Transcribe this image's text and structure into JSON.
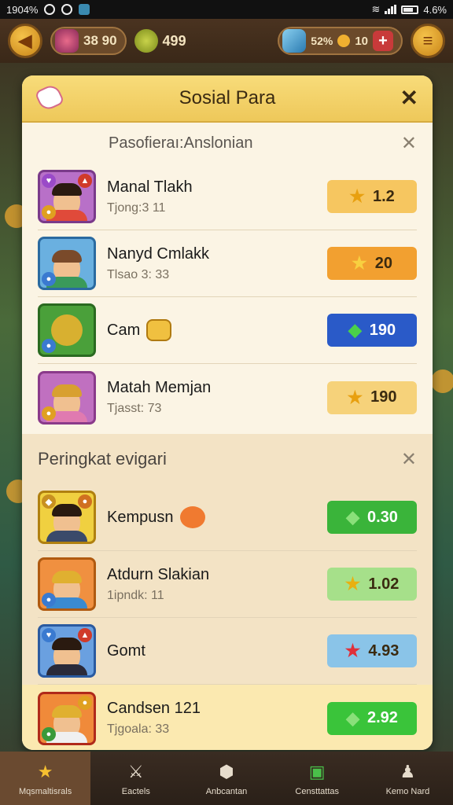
{
  "status_bar": {
    "left_text": "1904%",
    "right_text": "4.6%"
  },
  "top_bar": {
    "resource1": "38 90",
    "resource2": "499",
    "resource3_a": "52%",
    "resource3_b": "10"
  },
  "panel": {
    "title": "Sosial Para",
    "section_friends": {
      "heading": "Pasofieraı:Anslonian",
      "rows": [
        {
          "name": "Manal Tlakh",
          "sub": "Tjong:3 11",
          "score": "1.2",
          "score_icon": "star-icon",
          "btn_color": "#f6c660"
        },
        {
          "name": "Nanyd Cmlakk",
          "sub": "Tlsao 3: 33",
          "score": "20",
          "score_icon": "star-icon",
          "btn_color": "#f2a030"
        },
        {
          "name": "Cam",
          "sub": "",
          "score": "190",
          "score_icon": "gem-icon",
          "btn_color": "#2a5ac8"
        },
        {
          "name": "Matah Memjan",
          "sub": "Tjasst: 73",
          "score": "190",
          "score_icon": "star-icon",
          "btn_color": "#f6d27a"
        }
      ]
    },
    "section_ranking": {
      "heading": "Peringkat evigari",
      "rows": [
        {
          "name": "Kempusn",
          "sub": "",
          "score": "0.30",
          "score_icon": "gem-icon",
          "btn_color": "#3ab43a"
        },
        {
          "name": "Atdurn Slakian",
          "sub": "1ipndk: 11",
          "score": "1.02",
          "score_icon": "star-icon",
          "btn_color": "#a6e08a"
        },
        {
          "name": "Gomt",
          "sub": "",
          "score": "4.93",
          "score_icon": "star-icon",
          "btn_color": "#8ac4e8"
        },
        {
          "name": "Candsen 121",
          "sub": "Tjgoala: 33",
          "score": "2.92",
          "score_icon": "gem-icon",
          "btn_color": "#3ac43a"
        }
      ]
    }
  },
  "bottom_nav": [
    {
      "label": "Mqsmaltisrals",
      "icon": "star-icon"
    },
    {
      "label": "Eactels",
      "icon": "sword-icon"
    },
    {
      "label": "Anbcantan",
      "icon": "shield-icon"
    },
    {
      "label": "Censttattas",
      "icon": "chat-icon"
    },
    {
      "label": "Kemo Nard",
      "icon": "profile-icon"
    }
  ]
}
